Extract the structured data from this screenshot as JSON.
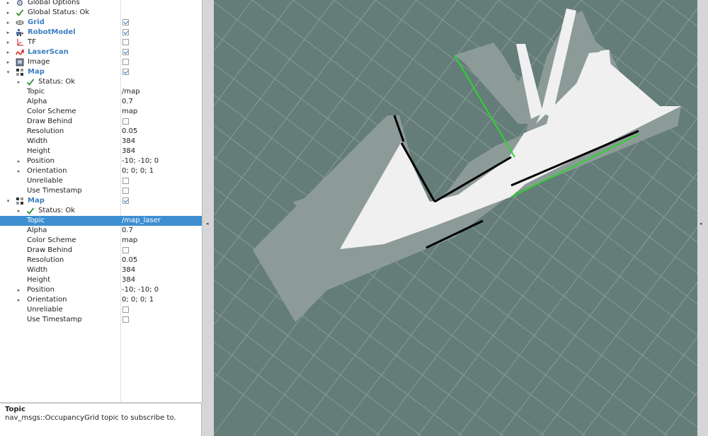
{
  "displays_tree": {
    "rows": [
      {
        "label": "Global Options",
        "bold": false,
        "depth": 0,
        "arrow": "▸",
        "icon": "gear-icon",
        "value": null,
        "checkbox": null,
        "selected": false
      },
      {
        "label": "Global Status: Ok",
        "bold": false,
        "depth": 0,
        "arrow": "▸",
        "icon": "checkmark-icon",
        "value": null,
        "checkbox": null,
        "selected": false
      },
      {
        "label": "Grid",
        "bold": true,
        "depth": 0,
        "arrow": "▸",
        "icon": "grid-icon",
        "value": null,
        "checkbox": true,
        "selected": false
      },
      {
        "label": "RobotModel",
        "bold": true,
        "depth": 0,
        "arrow": "▸",
        "icon": "robot-icon",
        "value": null,
        "checkbox": true,
        "selected": false
      },
      {
        "label": "TF",
        "bold": false,
        "depth": 0,
        "arrow": "▸",
        "icon": "tf-axes-icon",
        "value": null,
        "checkbox": false,
        "selected": false
      },
      {
        "label": "LaserScan",
        "bold": true,
        "depth": 0,
        "arrow": "▸",
        "icon": "laserscan-icon",
        "value": null,
        "checkbox": true,
        "selected": false
      },
      {
        "label": "Image",
        "bold": false,
        "depth": 0,
        "arrow": "▸",
        "icon": "image-icon",
        "value": null,
        "checkbox": false,
        "selected": false
      },
      {
        "label": "Map",
        "bold": true,
        "depth": 0,
        "arrow": "▾",
        "icon": "map-icon",
        "value": null,
        "checkbox": true,
        "selected": false
      },
      {
        "label": "Status: Ok",
        "bold": false,
        "depth": 1,
        "arrow": "▸",
        "icon": "checkmark-icon",
        "value": null,
        "checkbox": null,
        "selected": false
      },
      {
        "label": "Topic",
        "bold": false,
        "depth": 2,
        "arrow": "",
        "icon": "",
        "value": "/map",
        "checkbox": null,
        "selected": false
      },
      {
        "label": "Alpha",
        "bold": false,
        "depth": 2,
        "arrow": "",
        "icon": "",
        "value": "0.7",
        "checkbox": null,
        "selected": false
      },
      {
        "label": "Color Scheme",
        "bold": false,
        "depth": 2,
        "arrow": "",
        "icon": "",
        "value": "map",
        "checkbox": null,
        "selected": false
      },
      {
        "label": "Draw Behind",
        "bold": false,
        "depth": 2,
        "arrow": "",
        "icon": "",
        "value": null,
        "checkbox": false,
        "selected": false
      },
      {
        "label": "Resolution",
        "bold": false,
        "depth": 2,
        "arrow": "",
        "icon": "",
        "value": "0.05",
        "checkbox": null,
        "selected": false
      },
      {
        "label": "Width",
        "bold": false,
        "depth": 2,
        "arrow": "",
        "icon": "",
        "value": "384",
        "checkbox": null,
        "selected": false
      },
      {
        "label": "Height",
        "bold": false,
        "depth": 2,
        "arrow": "",
        "icon": "",
        "value": "384",
        "checkbox": null,
        "selected": false
      },
      {
        "label": "Position",
        "bold": false,
        "depth": 1,
        "arrow": "▸",
        "icon": "",
        "value": "-10; -10; 0",
        "checkbox": null,
        "selected": false
      },
      {
        "label": "Orientation",
        "bold": false,
        "depth": 1,
        "arrow": "▸",
        "icon": "",
        "value": "0; 0; 0; 1",
        "checkbox": null,
        "selected": false
      },
      {
        "label": "Unreliable",
        "bold": false,
        "depth": 2,
        "arrow": "",
        "icon": "",
        "value": null,
        "checkbox": false,
        "selected": false
      },
      {
        "label": "Use Timestamp",
        "bold": false,
        "depth": 2,
        "arrow": "",
        "icon": "",
        "value": null,
        "checkbox": false,
        "selected": false
      },
      {
        "label": "Map",
        "bold": true,
        "depth": 0,
        "arrow": "▾",
        "icon": "map-icon",
        "value": null,
        "checkbox": true,
        "selected": false
      },
      {
        "label": "Status: Ok",
        "bold": false,
        "depth": 1,
        "arrow": "▸",
        "icon": "checkmark-icon",
        "value": null,
        "checkbox": null,
        "selected": false
      },
      {
        "label": "Topic",
        "bold": false,
        "depth": 2,
        "arrow": "",
        "icon": "",
        "value": "/map_laser",
        "checkbox": null,
        "selected": true
      },
      {
        "label": "Alpha",
        "bold": false,
        "depth": 2,
        "arrow": "",
        "icon": "",
        "value": "0.7",
        "checkbox": null,
        "selected": false
      },
      {
        "label": "Color Scheme",
        "bold": false,
        "depth": 2,
        "arrow": "",
        "icon": "",
        "value": "map",
        "checkbox": null,
        "selected": false
      },
      {
        "label": "Draw Behind",
        "bold": false,
        "depth": 2,
        "arrow": "",
        "icon": "",
        "value": null,
        "checkbox": false,
        "selected": false
      },
      {
        "label": "Resolution",
        "bold": false,
        "depth": 2,
        "arrow": "",
        "icon": "",
        "value": "0.05",
        "checkbox": null,
        "selected": false
      },
      {
        "label": "Width",
        "bold": false,
        "depth": 2,
        "arrow": "",
        "icon": "",
        "value": "384",
        "checkbox": null,
        "selected": false
      },
      {
        "label": "Height",
        "bold": false,
        "depth": 2,
        "arrow": "",
        "icon": "",
        "value": "384",
        "checkbox": null,
        "selected": false
      },
      {
        "label": "Position",
        "bold": false,
        "depth": 1,
        "arrow": "▸",
        "icon": "",
        "value": "-10; -10; 0",
        "checkbox": null,
        "selected": false
      },
      {
        "label": "Orientation",
        "bold": false,
        "depth": 1,
        "arrow": "▸",
        "icon": "",
        "value": "0; 0; 0; 1",
        "checkbox": null,
        "selected": false
      },
      {
        "label": "Unreliable",
        "bold": false,
        "depth": 2,
        "arrow": "",
        "icon": "",
        "value": null,
        "checkbox": false,
        "selected": false
      },
      {
        "label": "Use Timestamp",
        "bold": false,
        "depth": 2,
        "arrow": "",
        "icon": "",
        "value": null,
        "checkbox": false,
        "selected": false
      }
    ]
  },
  "help": {
    "title": "Topic",
    "text": "nav_msgs::OccupancyGrid topic to subscribe to."
  },
  "colors": {
    "selection": "#3d8fd1",
    "display_name": "#3a7ec0",
    "viewport_background": "#647d79",
    "grid_line": "#8a9c99",
    "free_space": "#f0f0f0",
    "unknown_space": "#8d9b98",
    "obstacle": "#000000",
    "laser_scan": "#2ad62a"
  },
  "splitter": {
    "left_arrow": "◂",
    "right_arrow": "◂"
  }
}
